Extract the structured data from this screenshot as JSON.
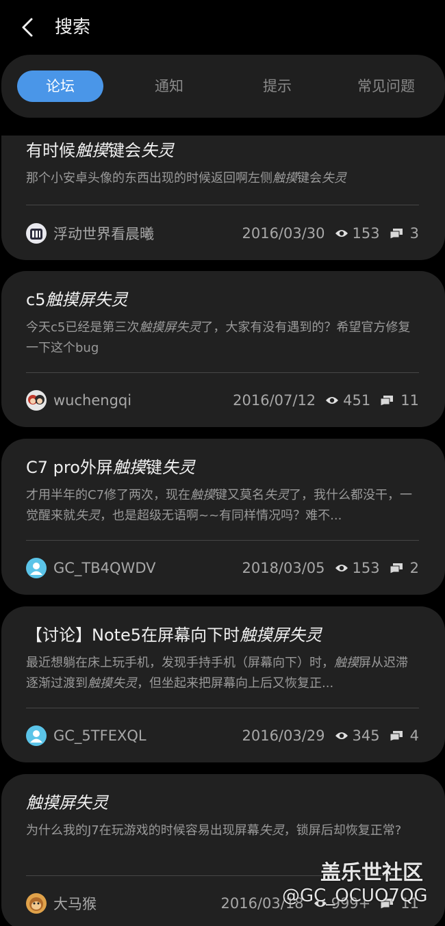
{
  "header": {
    "title": "搜索"
  },
  "tabs": [
    {
      "label": "论坛",
      "active": true
    },
    {
      "label": "通知",
      "active": false
    },
    {
      "label": "提示",
      "active": false
    },
    {
      "label": "常见问题",
      "active": false
    }
  ],
  "colors": {
    "accent": "#4a96e8",
    "card": "#212121",
    "background": "#000000"
  },
  "posts": [
    {
      "title_parts": [
        "有时候",
        "触摸",
        "键会",
        "失灵"
      ],
      "snippet_parts": [
        "那个小安卓头像的东西出现的时候返回啊左侧",
        "触摸",
        "键会",
        "失灵"
      ],
      "author": "浮动世界看晨曦",
      "avatar_icon": "user-avatar-icon",
      "date": "2016/03/30",
      "views": "153",
      "comments": "3"
    },
    {
      "title_parts": [
        "c5",
        "触摸屏",
        "失灵"
      ],
      "snippet_parts": [
        "今天c5已经是第三次",
        "触摸屏",
        "失灵",
        "了，大家有没有遇到的？希望官方修复一下这个bug"
      ],
      "author": "wuchengqi",
      "avatar_icon": "user-avatar-icon",
      "date": "2016/07/12",
      "views": "451",
      "comments": "11"
    },
    {
      "title_parts": [
        "C7 pro外屏",
        "触摸",
        "键",
        "失灵"
      ],
      "snippet_parts": [
        "才用半年的C7修了两次，现在",
        "触摸",
        "键又莫名",
        "失灵",
        "了，我什么都没干，一觉醒来就",
        "失灵",
        "，也是超级无语啊~~有同样情况吗？难不..."
      ],
      "author": "GC_TB4QWDV",
      "avatar_icon": "default-avatar-icon",
      "date": "2018/03/05",
      "views": "153",
      "comments": "2"
    },
    {
      "title_parts": [
        "【讨论】Note5在屏幕向下时",
        "触摸屏",
        "失灵"
      ],
      "snippet_parts": [
        "最近想躺在床上玩手机，发现手持手机（屏幕向下）时，",
        "触摸",
        "屏从迟滞逐渐过渡到",
        "触摸",
        "失灵",
        "，但坐起来把屏幕向上后又恢复正..."
      ],
      "author": "GC_5TFEXQL",
      "avatar_icon": "default-avatar-icon",
      "date": "2016/03/29",
      "views": "345",
      "comments": "4"
    },
    {
      "title_parts": [
        "触摸屏",
        "失灵"
      ],
      "snippet_parts": [
        "为什么我的J7在玩游戏的时候容易出现屏幕",
        "失灵",
        "，锁屏后却恢复正常?"
      ],
      "author": "大马猴",
      "avatar_icon": "monkey-avatar-icon",
      "date": "2016/03/18",
      "views": "999+",
      "comments": "11"
    }
  ],
  "watermark": {
    "line1": "盖乐世社区",
    "line2": "@GC_OCUO7QG"
  }
}
